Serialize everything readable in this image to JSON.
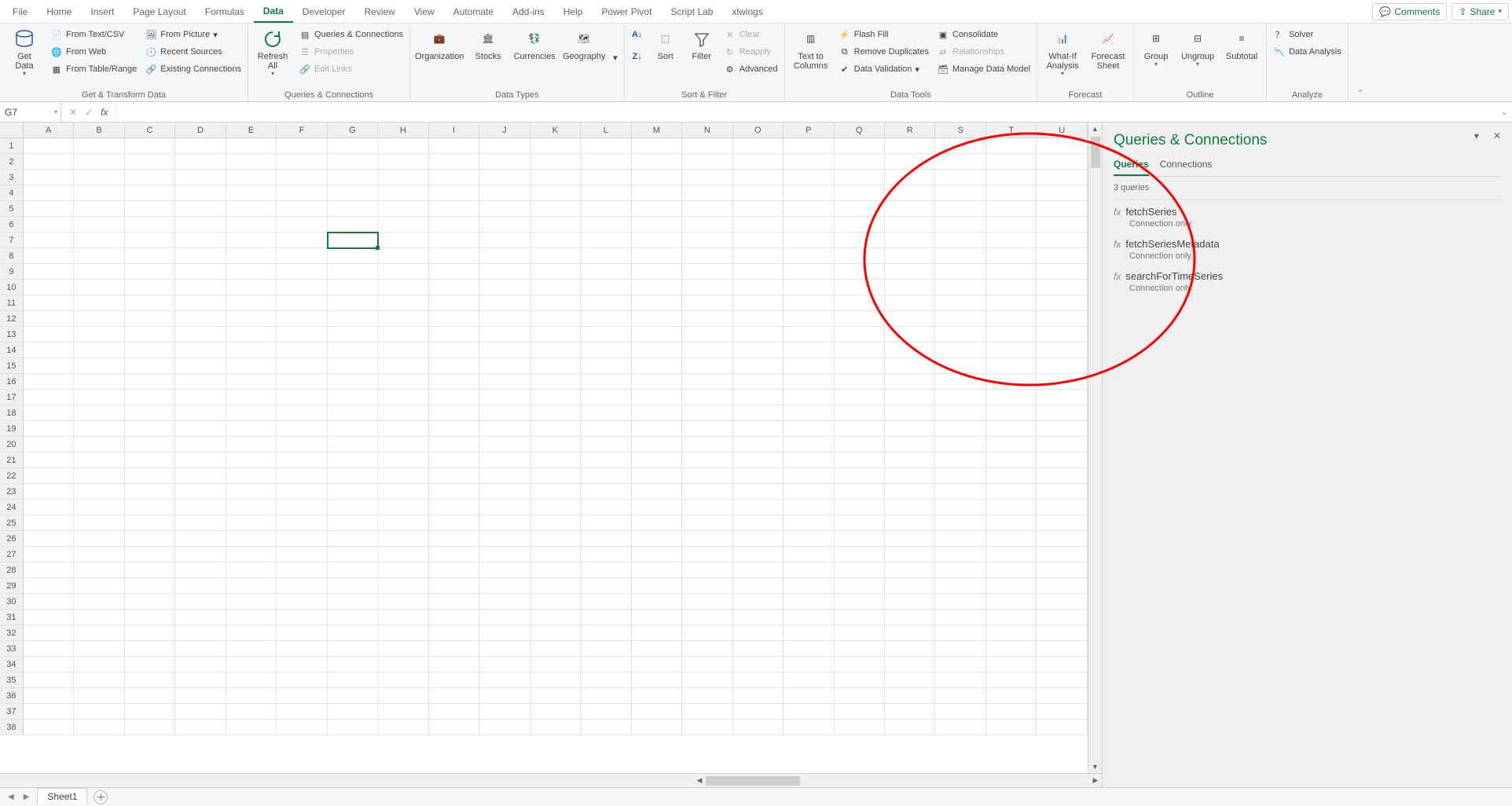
{
  "tabs": {
    "items": [
      "File",
      "Home",
      "Insert",
      "Page Layout",
      "Formulas",
      "Data",
      "Developer",
      "Review",
      "View",
      "Automate",
      "Add-ins",
      "Help",
      "Power Pivot",
      "Script Lab",
      "xlwings"
    ],
    "active": "Data"
  },
  "topButtons": {
    "comments": "Comments",
    "share": "Share"
  },
  "ribbon": {
    "groups": {
      "getTransform": {
        "label": "Get & Transform Data",
        "getData": "Get\nData",
        "fromTextCsv": "From Text/CSV",
        "fromWeb": "From Web",
        "fromTableRange": "From Table/Range",
        "fromPicture": "From Picture",
        "recentSources": "Recent Sources",
        "existingConnections": "Existing Connections"
      },
      "queriesConnections": {
        "label": "Queries & Connections",
        "refreshAll": "Refresh\nAll",
        "queriesConnections": "Queries & Connections",
        "properties": "Properties",
        "editLinks": "Edit Links"
      },
      "dataTypes": {
        "label": "Data Types",
        "organization": "Organization",
        "stocks": "Stocks",
        "currencies": "Currencies",
        "geography": "Geography"
      },
      "sortFilter": {
        "label": "Sort & Filter",
        "sort": "Sort",
        "filter": "Filter",
        "clear": "Clear",
        "reapply": "Reapply",
        "advanced": "Advanced"
      },
      "dataTools": {
        "label": "Data Tools",
        "textToColumns": "Text to\nColumns",
        "flashFill": "Flash Fill",
        "removeDuplicates": "Remove Duplicates",
        "dataValidation": "Data Validation",
        "consolidate": "Consolidate",
        "relationships": "Relationships",
        "manageDataModel": "Manage Data Model"
      },
      "forecast": {
        "label": "Forecast",
        "whatIf": "What-If\nAnalysis",
        "forecastSheet": "Forecast\nSheet"
      },
      "outline": {
        "label": "Outline",
        "group": "Group",
        "ungroup": "Ungroup",
        "subtotal": "Subtotal"
      },
      "analyze": {
        "label": "Analyze",
        "solver": "Solver",
        "dataAnalysis": "Data Analysis"
      }
    }
  },
  "formulaBar": {
    "nameBox": "G7",
    "formula": ""
  },
  "grid": {
    "columns": [
      "A",
      "B",
      "C",
      "D",
      "E",
      "F",
      "G",
      "H",
      "I",
      "J",
      "K",
      "L",
      "M",
      "N",
      "O",
      "P",
      "Q",
      "R",
      "S",
      "T",
      "U"
    ],
    "rowCount": 38,
    "selected": {
      "row": 7,
      "col": "G"
    }
  },
  "pane": {
    "title": "Queries & Connections",
    "tabs": {
      "queries": "Queries",
      "connections": "Connections",
      "active": "Queries"
    },
    "countLabel": "3 queries",
    "items": [
      {
        "name": "fetchSeries",
        "status": "Connection only."
      },
      {
        "name": "fetchSeriesMetadata",
        "status": "Connection only."
      },
      {
        "name": "searchForTimeSeries",
        "status": "Connection only."
      }
    ]
  },
  "sheetBar": {
    "sheets": [
      "Sheet1"
    ]
  }
}
